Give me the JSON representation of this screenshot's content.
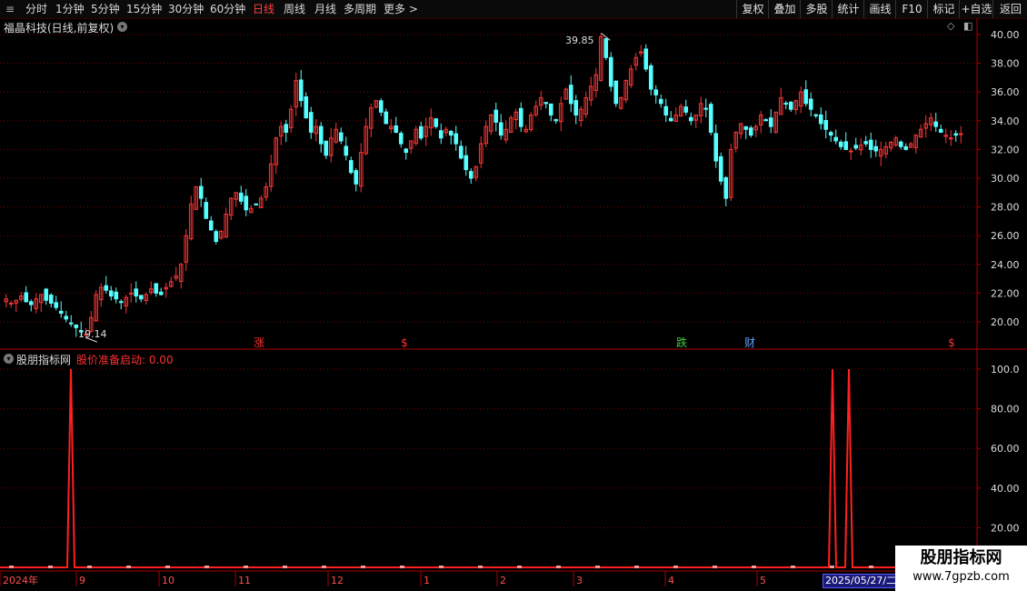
{
  "toolbar": {
    "periods": [
      "分时",
      "1分钟",
      "5分钟",
      "15分钟",
      "30分钟",
      "60分钟",
      "日线",
      "周线",
      "月线",
      "多周期",
      "更多 >"
    ],
    "active": "日线",
    "right": [
      "复权",
      "叠加",
      "多股",
      "统计",
      "画线",
      "F10",
      "标记",
      "+自选",
      "返回"
    ]
  },
  "main_chart": {
    "title": "福晶科技(日线,前复权)",
    "price_axis": [
      "40.00",
      "38.00",
      "36.00",
      "34.00",
      "32.00",
      "30.00",
      "28.00",
      "26.00",
      "24.00",
      "22.00",
      "20.00"
    ],
    "high_label": "39.85",
    "low_label": "19.14",
    "markers": [
      {
        "text": "涨",
        "color": "#ff3030"
      },
      {
        "text": "$",
        "color": "#ff3030"
      },
      {
        "text": "跌",
        "color": "#40d040"
      },
      {
        "text": "财",
        "color": "#60a0ff"
      },
      {
        "text": "$",
        "color": "#ff3030"
      }
    ]
  },
  "indicator": {
    "name": "股朋指标网",
    "line_label": "股价准备启动: 0.00",
    "axis": [
      "100.0",
      "80.00",
      "60.00",
      "40.00",
      "20.00"
    ]
  },
  "date_axis": [
    "2024年",
    "9",
    "10",
    "11",
    "12",
    "1",
    "2",
    "3",
    "4",
    "5"
  ],
  "date_box": "2025/05/27/二",
  "watermark": {
    "line1": "股朋指标网",
    "line2": "www.7gpzb.com"
  },
  "colors": {
    "up": "#ff3232",
    "down": "#54ffff",
    "grid": "#7a0000",
    "accent": "#ff3030"
  },
  "chart_data": {
    "type": "candlestick",
    "ylim": [
      19,
      41
    ],
    "close_path": [
      21.6,
      21.3,
      21.5,
      21.8,
      21.4,
      21.2,
      21.6,
      21.9,
      21.5,
      21.3,
      21.0,
      20.6,
      20.2,
      19.9,
      19.6,
      19.3,
      19.14,
      20.3,
      21.9,
      22.4,
      22.2,
      21.8,
      21.6,
      21.4,
      21.7,
      22.0,
      21.8,
      21.6,
      21.9,
      22.3,
      22.0,
      21.9,
      22.4,
      22.8,
      23.2,
      24.0,
      26.0,
      28.2,
      29.4,
      28.6,
      27.2,
      26.4,
      25.6,
      26.3,
      27.5,
      28.6,
      29.0,
      28.4,
      27.8,
      27.9,
      28.2,
      28.6,
      29.4,
      31.0,
      32.8,
      33.6,
      33.2,
      34.8,
      36.8,
      35.4,
      34.2,
      33.2,
      33.6,
      32.4,
      31.6,
      32.8,
      33.4,
      32.6,
      31.6,
      30.4,
      29.6,
      31.8,
      33.6,
      34.9,
      35.4,
      34.6,
      33.8,
      33.6,
      33.2,
      32.4,
      31.8,
      32.6,
      33.4,
      32.8,
      33.6,
      34.2,
      33.6,
      32.8,
      33.4,
      33.0,
      32.4,
      31.4,
      30.6,
      30.0,
      30.8,
      32.4,
      33.6,
      34.4,
      33.9,
      33.0,
      33.4,
      34.2,
      34.6,
      33.6,
      33.4,
      34.4,
      35.0,
      35.6,
      35.2,
      34.4,
      34.0,
      35.2,
      36.2,
      35.2,
      34.4,
      34.8,
      35.6,
      36.4,
      37.2,
      39.85,
      38.4,
      36.4,
      35.2,
      35.6,
      36.8,
      37.6,
      38.4,
      38.8,
      37.6,
      36.2,
      35.8,
      35.2,
      34.4,
      34.0,
      34.4,
      35.0,
      34.6,
      34.0,
      34.4,
      35.2,
      34.8,
      33.2,
      31.2,
      29.8,
      28.6,
      32.0,
      33.2,
      33.8,
      33.4,
      33.0,
      33.6,
      34.4,
      34.0,
      33.6,
      34.6,
      35.6,
      35.2,
      34.8,
      35.4,
      36.0,
      35.2,
      34.8,
      34.4,
      33.8,
      33.4,
      33.0,
      32.6,
      32.2,
      32.0,
      31.9,
      32.1,
      32.3,
      32.4,
      32.0,
      31.9,
      32.0,
      32.2,
      32.5,
      32.8,
      32.2,
      32.0,
      32.4,
      33.0,
      33.4,
      33.8,
      34.2,
      33.6,
      33.2,
      33.0,
      32.8,
      33.0,
      33.1
    ]
  }
}
